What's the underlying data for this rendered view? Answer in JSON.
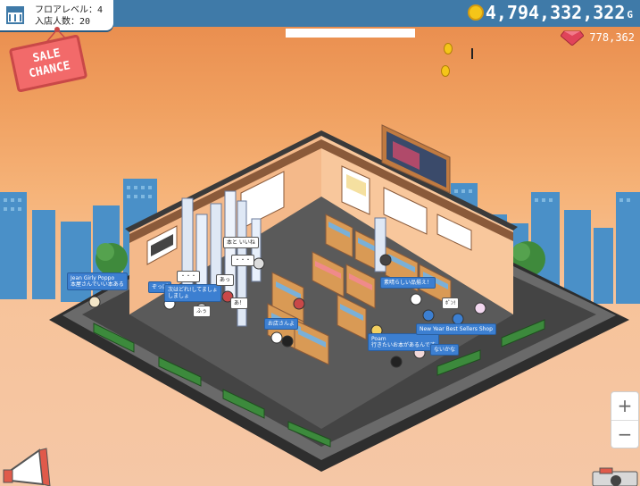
{
  "hud": {
    "floor_level": "フロアレベル：4",
    "visitors": "入店人数：20",
    "sale_line1": "SALE",
    "sale_line2": "CHANCE",
    "gold_amount": "4,794,332,322",
    "gold_unit": "G",
    "gem_amount": "778,362",
    "zoom_in": "+",
    "zoom_out": "−"
  },
  "bubbles": [
    {
      "text": "Jean Girly Poppo",
      "style": "blue"
    },
    {
      "text": "本屋さんでいい本ある",
      "style": "blue"
    },
    {
      "text": "ぞっぱ",
      "style": "blue"
    },
    {
      "text": "次はどれ!してましょ",
      "style": "blue"
    },
    {
      "text": "しましょ",
      "style": "blue"
    },
    {
      "text": "・・・",
      "style": "white"
    },
    {
      "text": "あっ",
      "style": "white"
    },
    {
      "text": "本と いいね",
      "style": "white"
    },
    {
      "text": "・・・",
      "style": "white"
    },
    {
      "text": "あ！",
      "style": "white"
    },
    {
      "text": "ふぅ",
      "style": "white"
    },
    {
      "text": "素晴らしい品揃え！",
      "style": "blue"
    },
    {
      "text": "ﾎﾟﾝ!",
      "style": "white"
    },
    {
      "text": "お店さんよ",
      "style": "blue"
    },
    {
      "text": "Poam",
      "style": "blue"
    },
    {
      "text": "New Year Best Sellers Shop",
      "style": "blue"
    },
    {
      "text": "行きたいお本があるんです",
      "style": "blue"
    },
    {
      "text": "ないかな",
      "style": "blue"
    }
  ],
  "colors": {
    "topbar": "#3f7aa8",
    "sale_sign": "#f26a6a",
    "gold_coin": "#f5c518",
    "wall": "#f4b98a",
    "floor": "#5a5a5a",
    "bookshelf": "#d99a55",
    "building": "#4a90c8"
  },
  "icons": {
    "store": "store-icon",
    "gold": "gold-coin-icon",
    "gem": "ruby-gem-icon",
    "megaphone": "megaphone-icon",
    "camera": "camera-icon"
  }
}
